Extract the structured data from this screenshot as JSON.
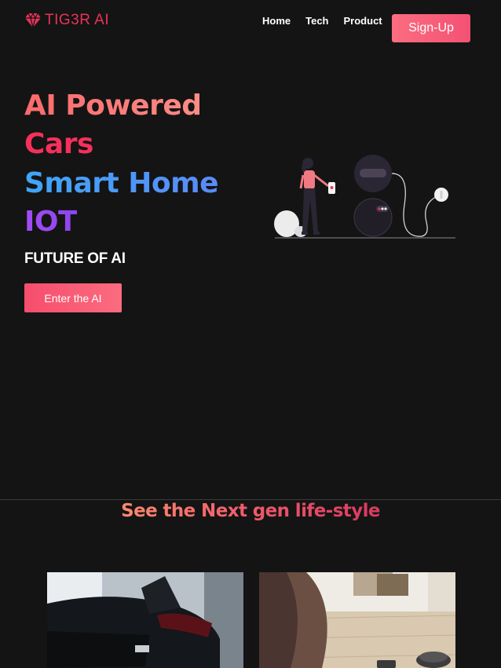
{
  "nav": {
    "brand": "TIG3R AI",
    "brand_icon": "diamond-icon",
    "links": [
      "Home",
      "Tech",
      "Product"
    ],
    "signup_label": "Sign-Up"
  },
  "hero": {
    "lines": [
      "AI Powered",
      "Cars",
      "Smart Home",
      "IOT"
    ],
    "tagline": "FUTURE OF AI",
    "cta_label": "Enter the AI",
    "illustration": "person-with-robot-illustration"
  },
  "section": {
    "title": "See the Next gen life-style"
  },
  "cards": [
    {
      "image": "car-photo"
    },
    {
      "image": "robot-vacuum-home-photo"
    }
  ],
  "colors": {
    "background": "#141414",
    "accent": "#f5305b",
    "button": "#f64d6d",
    "blue": "#3fa6f7",
    "purple": "#a34cf6"
  }
}
